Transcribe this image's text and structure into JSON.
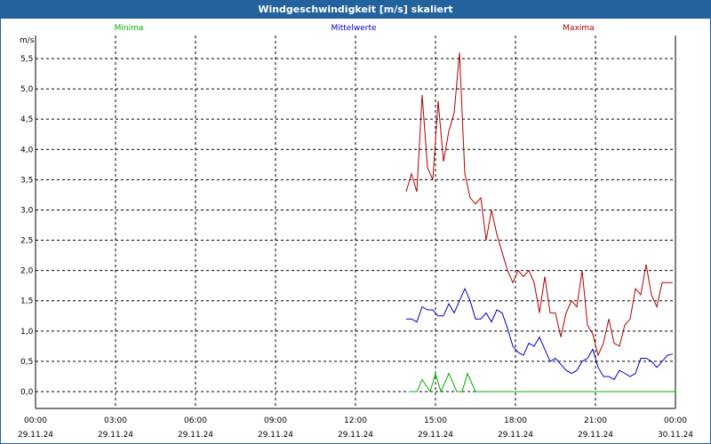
{
  "title": "Windgeschwindigkeit [m/s] skaliert",
  "colors": {
    "titlebar": "#23629c",
    "minima": "#00b000",
    "mittel": "#0000c8",
    "maxima": "#b00000"
  },
  "chart_data": {
    "type": "line",
    "title": "Windgeschwindigkeit [m/s] skaliert",
    "ylabel": "m/s",
    "ylim": [
      -0.2,
      5.9
    ],
    "xlim": [
      0,
      24
    ],
    "grid": true,
    "legend_position": "top",
    "y_ticks": [
      "0,0",
      "0,5",
      "1,0",
      "1,5",
      "2,0",
      "2,5",
      "3,0",
      "3,5",
      "4,0",
      "4,5",
      "5,0",
      "5,5"
    ],
    "y_tick_values": [
      0,
      0.5,
      1,
      1.5,
      2,
      2.5,
      3,
      3.5,
      4,
      4.5,
      5,
      5.5
    ],
    "x_ticks": [
      {
        "time": "00:00",
        "date": "29.11.24"
      },
      {
        "time": "03:00",
        "date": "29.11.24"
      },
      {
        "time": "06:00",
        "date": "29.11.24"
      },
      {
        "time": "09:00",
        "date": "29.11.24"
      },
      {
        "time": "12:00",
        "date": "29.11.24"
      },
      {
        "time": "15:00",
        "date": "29.11.24"
      },
      {
        "time": "18:00",
        "date": "29.11.24"
      },
      {
        "time": "21:00",
        "date": "29.11.24"
      },
      {
        "time": "00:00",
        "date": "30.11.24"
      }
    ],
    "series": [
      {
        "name": "Minima",
        "color": "#00b000",
        "x": [
          14.0,
          14.3,
          14.5,
          14.8,
          15.0,
          15.2,
          15.5,
          15.8,
          16.0,
          16.2,
          16.5,
          17.0,
          18.0,
          19.0,
          20.0,
          21.0,
          22.0,
          23.0,
          24.0
        ],
        "values": [
          0,
          0,
          0.2,
          0,
          0.3,
          0,
          0.3,
          0,
          0,
          0.3,
          0,
          0,
          0,
          0,
          0,
          0,
          0,
          0,
          0
        ]
      },
      {
        "name": "Mittelwerte",
        "color": "#0000c8",
        "x": [
          13.9,
          14.1,
          14.3,
          14.5,
          14.7,
          14.9,
          15.1,
          15.3,
          15.5,
          15.7,
          15.9,
          16.1,
          16.3,
          16.5,
          16.7,
          16.9,
          17.1,
          17.3,
          17.5,
          17.7,
          17.9,
          18.1,
          18.3,
          18.5,
          18.7,
          18.9,
          19.1,
          19.3,
          19.5,
          19.7,
          19.9,
          20.1,
          20.3,
          20.5,
          20.7,
          20.9,
          21.1,
          21.3,
          21.5,
          21.7,
          21.9,
          22.1,
          22.3,
          22.5,
          22.7,
          22.9,
          23.1,
          23.3,
          23.5,
          23.7,
          23.9
        ],
        "values": [
          1.2,
          1.2,
          1.15,
          1.4,
          1.35,
          1.35,
          1.25,
          1.25,
          1.45,
          1.3,
          1.5,
          1.7,
          1.5,
          1.2,
          1.2,
          1.3,
          1.15,
          1.35,
          1.3,
          1.05,
          0.75,
          0.65,
          0.6,
          0.8,
          0.75,
          0.9,
          0.7,
          0.5,
          0.55,
          0.45,
          0.35,
          0.3,
          0.35,
          0.5,
          0.55,
          0.7,
          0.4,
          0.25,
          0.25,
          0.2,
          0.35,
          0.3,
          0.25,
          0.3,
          0.55,
          0.55,
          0.5,
          0.4,
          0.5,
          0.6,
          0.62
        ]
      },
      {
        "name": "Maxima",
        "color": "#b00000",
        "x": [
          13.9,
          14.1,
          14.3,
          14.5,
          14.7,
          14.9,
          15.1,
          15.3,
          15.5,
          15.7,
          15.9,
          16.1,
          16.3,
          16.5,
          16.7,
          16.9,
          17.1,
          17.3,
          17.5,
          17.7,
          17.9,
          18.1,
          18.3,
          18.5,
          18.7,
          18.9,
          19.1,
          19.3,
          19.5,
          19.7,
          19.9,
          20.1,
          20.3,
          20.5,
          20.7,
          20.9,
          21.1,
          21.3,
          21.5,
          21.7,
          21.9,
          22.1,
          22.3,
          22.5,
          22.7,
          22.9,
          23.1,
          23.3,
          23.5,
          23.7,
          23.9
        ],
        "values": [
          3.3,
          3.6,
          3.3,
          4.9,
          3.7,
          3.5,
          4.8,
          3.8,
          4.3,
          4.6,
          5.6,
          3.6,
          3.2,
          3.1,
          3.2,
          2.5,
          3.0,
          2.6,
          2.3,
          2.0,
          1.8,
          2.0,
          1.9,
          2.0,
          1.8,
          1.3,
          1.9,
          1.3,
          1.3,
          0.9,
          1.3,
          1.5,
          1.4,
          2.0,
          1.1,
          0.95,
          0.6,
          0.8,
          1.2,
          0.8,
          0.75,
          1.1,
          1.2,
          1.7,
          1.6,
          2.1,
          1.6,
          1.4,
          1.8,
          1.8,
          1.8
        ]
      }
    ]
  }
}
